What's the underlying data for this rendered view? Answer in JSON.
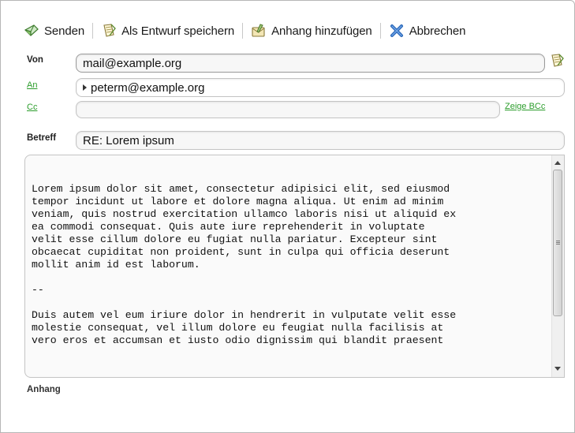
{
  "toolbar": {
    "send_label": "Senden",
    "draft_label": "Als Entwurf speichern",
    "attach_label": "Anhang hinzufügen",
    "cancel_label": "Abbrechen"
  },
  "from": {
    "label": "Von",
    "value": "mail@example.org"
  },
  "to": {
    "label": "An",
    "value": "peterm@example.org"
  },
  "cc": {
    "label": "Cc",
    "value": "",
    "show_bcc": "Zeige BCc"
  },
  "subject": {
    "label": "Betreff",
    "value": "RE: Lorem ipsum"
  },
  "body": {
    "text": "Lorem ipsum dolor sit amet, consectetur adipisici elit, sed eiusmod\ntempor incidunt ut labore et dolore magna aliqua. Ut enim ad minim\nveniam, quis nostrud exercitation ullamco laboris nisi ut aliquid ex\nea commodi consequat. Quis aute iure reprehenderit in voluptate\nvelit esse cillum dolore eu fugiat nulla pariatur. Excepteur sint\nobcaecat cupiditat non proident, sunt in culpa qui officia deserunt\nmollit anim id est laborum.\n\n--\n\nDuis autem vel eum iriure dolor in hendrerit in vulputate velit esse\nmolestie consequat, vel illum dolore eu feugiat nulla facilisis at\nvero eros et accumsan et iusto odio dignissim qui blandit praesent"
  },
  "attachments": {
    "label": "Anhang"
  },
  "icons": {
    "send": "send-icon",
    "draft": "note-icon",
    "attach": "attachment-icon",
    "cancel": "cross-icon",
    "address_book": "address-book-icon"
  },
  "colors": {
    "link": "#2c9d2c",
    "cancel_blue": "#2a67b8"
  }
}
